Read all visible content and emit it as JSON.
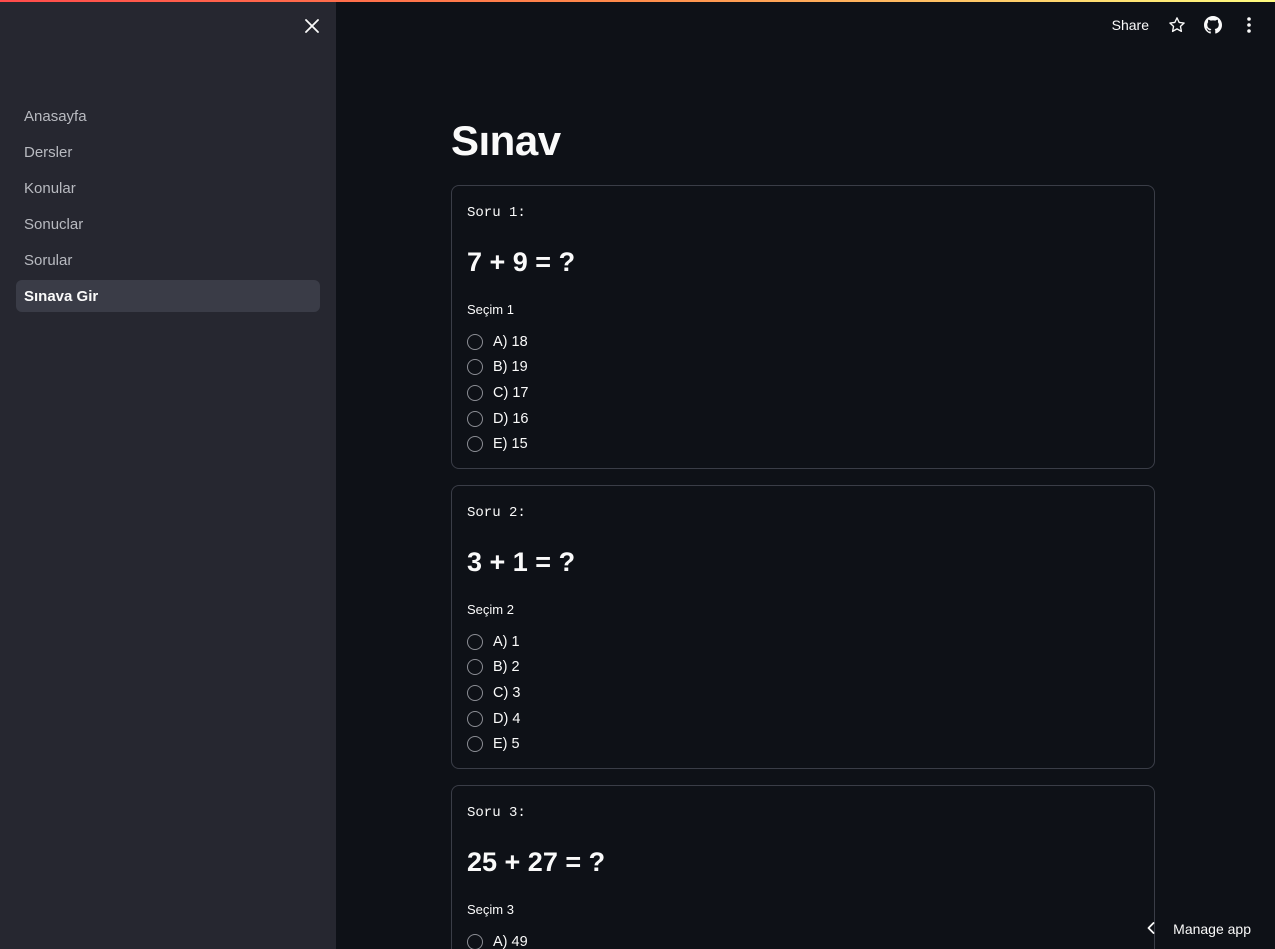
{
  "sidebar": {
    "items": [
      {
        "label": "Anasayfa"
      },
      {
        "label": "Dersler"
      },
      {
        "label": "Konular"
      },
      {
        "label": "Sonuclar"
      },
      {
        "label": "Sorular"
      },
      {
        "label": "Sınava Gir",
        "active": true
      }
    ]
  },
  "header": {
    "share_label": "Share"
  },
  "main": {
    "title": "Sınav",
    "questions": [
      {
        "label": "Soru 1:",
        "text": "7 + 9 = ?",
        "select_label": "Seçim 1",
        "options": [
          "A) 18",
          "B) 19",
          "C) 17",
          "D) 16",
          "E) 15"
        ]
      },
      {
        "label": "Soru 2:",
        "text": "3 + 1 = ?",
        "select_label": "Seçim 2",
        "options": [
          "A) 1",
          "B) 2",
          "C) 3",
          "D) 4",
          "E) 5"
        ]
      },
      {
        "label": "Soru 3:",
        "text": "25 + 27 = ?",
        "select_label": "Seçim 3",
        "options": [
          "A) 49"
        ]
      }
    ]
  },
  "footer": {
    "manage_label": "Manage app"
  },
  "colors": {
    "background": "#0e1117",
    "sidebar": "#262730",
    "accent": "#ff4b4b"
  },
  "icons": [
    "close-icon",
    "star-icon",
    "github-icon",
    "more-vertical-icon",
    "chevron-left-icon"
  ]
}
